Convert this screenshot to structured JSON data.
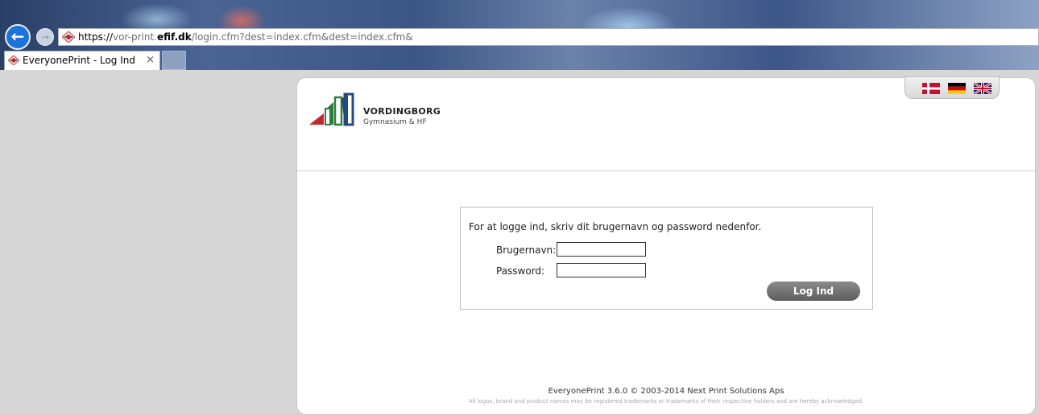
{
  "browser": {
    "url_protocol": "https://",
    "url_prefix": "vor-print.",
    "url_domain": "efif.dk",
    "url_path": "/login.cfm?dest=index.cfm&dest=index.cfm&",
    "tab_title": "EveryonePrint - Log Ind",
    "tab_close": "×",
    "back_icon": "back-arrow-icon",
    "forward_icon": "forward-arrow-icon"
  },
  "languages": [
    {
      "name": "danish-flag-icon"
    },
    {
      "name": "german-flag-icon"
    },
    {
      "name": "uk-flag-icon"
    }
  ],
  "logo": {
    "title": "VORDINGBORG",
    "subtitle": "Gymnasium & HF"
  },
  "login": {
    "intro": "For at logge ind, skriv dit brugernavn og password nedenfor.",
    "username_label": "Brugernavn:",
    "username_value": "",
    "password_label": "Password:",
    "password_value": "",
    "submit_label": "Log Ind"
  },
  "footer": {
    "copyright": "EveryonePrint 3.6.0 © 2003-2014 Next Print Solutions Aps",
    "disclaimer": "All logos, brand and product names may be registered trademarks or trademarks of their respective holders and are hereby acknowledged."
  },
  "colors": {
    "accent": "#1d74d8",
    "button": "#6f6f6f",
    "logo_red": "#c0282d",
    "logo_green": "#2e7d3a",
    "logo_blue": "#24497f"
  }
}
